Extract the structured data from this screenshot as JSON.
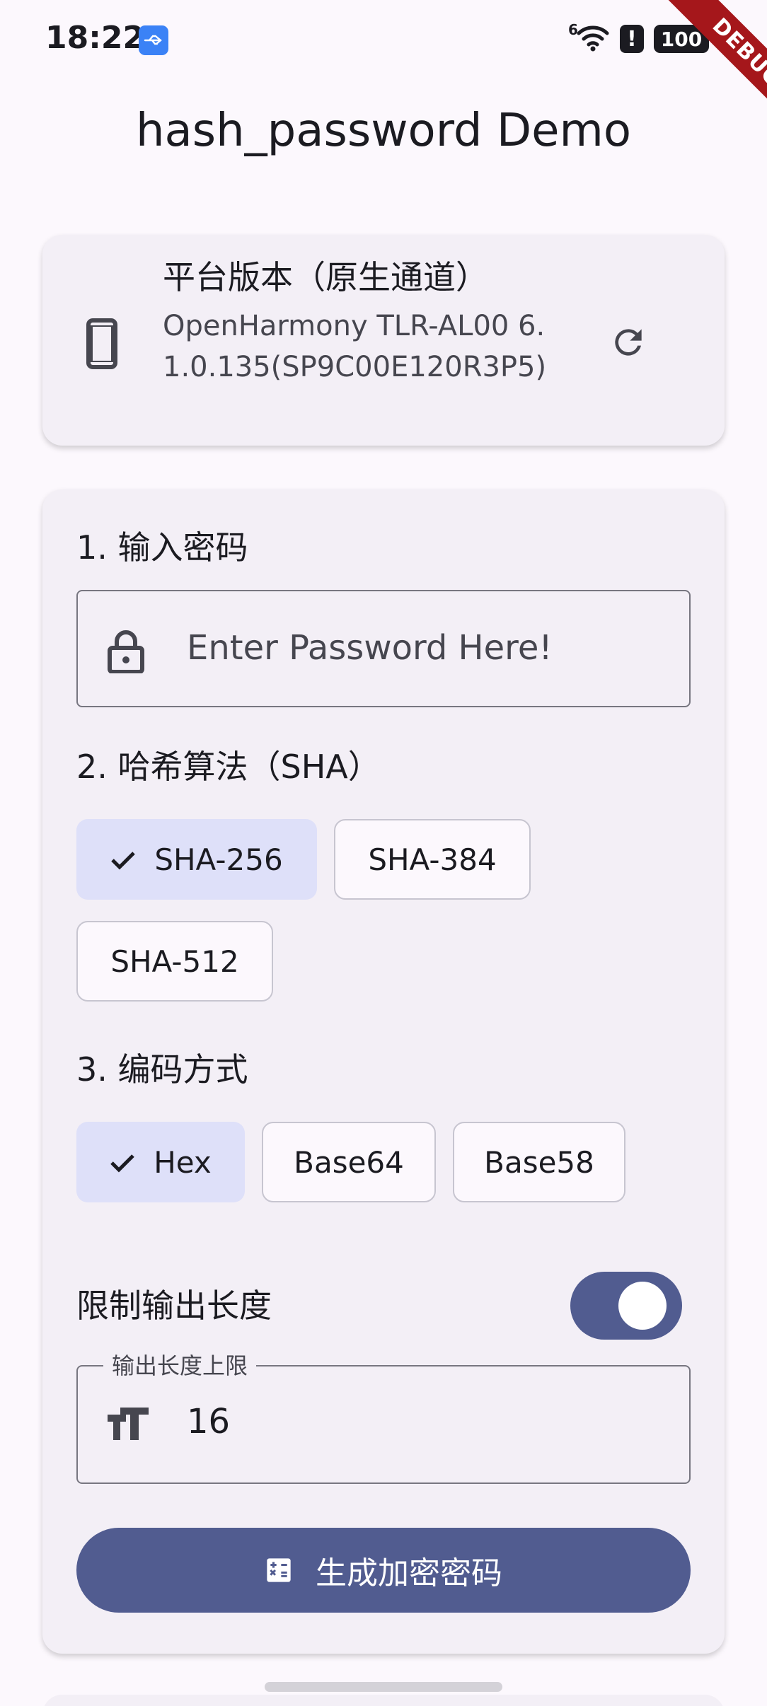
{
  "status_bar": {
    "time": "18:22",
    "network_label": "6",
    "battery": "100",
    "icons": [
      "usb-icon",
      "wifi-icon",
      "alert-icon",
      "battery-icon",
      "charging-icon"
    ]
  },
  "debug_banner": "DEBUG",
  "app_bar": {
    "title": "hash_password Demo"
  },
  "platform_card": {
    "title": "平台版本（原生通道）",
    "version": "OpenHarmony TLR-AL00 6.1.0.135(SP9C00E120R3P5)",
    "icons": [
      "phone-icon",
      "refresh-icon"
    ]
  },
  "form": {
    "password_section": "1. 输入密码",
    "password_placeholder": "Enter Password Here!",
    "algorithm_section": "2. 哈希算法（SHA）",
    "algorithms": [
      {
        "label": "SHA-256",
        "selected": true
      },
      {
        "label": "SHA-384",
        "selected": false
      },
      {
        "label": "SHA-512",
        "selected": false
      }
    ],
    "encoding_section": "3. 编码方式",
    "encodings": [
      {
        "label": "Hex",
        "selected": true
      },
      {
        "label": "Base64",
        "selected": false
      },
      {
        "label": "Base58",
        "selected": false
      }
    ],
    "limit_label": "限制输出长度",
    "limit_enabled": true,
    "length_field_label": "输出长度上限",
    "length_value": "16",
    "generate_button": "生成加密密码"
  },
  "colors": {
    "primary": "#515c90",
    "chip_selected": "#dee0f9",
    "card_background": "#f3eff6",
    "page_background": "#fcf8fd",
    "debug_banner": "#a5171b"
  }
}
